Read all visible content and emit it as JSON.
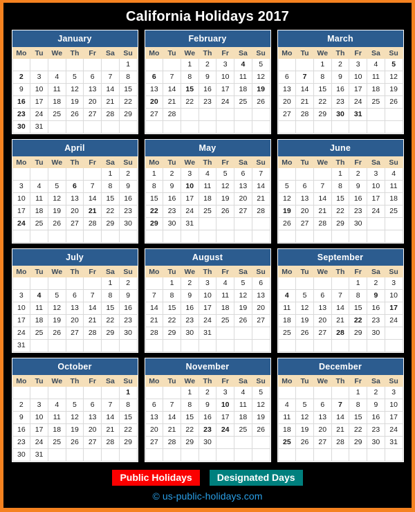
{
  "page": {
    "title": "California Holidays 2017",
    "background_color": "#000000",
    "border_color": "#f58220"
  },
  "weekday_headers": [
    "Mo",
    "Tu",
    "We",
    "Th",
    "Fr",
    "Sa",
    "Su"
  ],
  "legend": {
    "public_holidays_label": "Public Holidays",
    "public_holidays_color": "#fb0000",
    "designated_days_label": "Designated Days",
    "designated_days_color": "#00807e"
  },
  "copyright": "© us-public-holidays.com",
  "colors": {
    "month_header_bg": "#2c5c8f",
    "weekday_header_bg": "#f5dfb9",
    "saturday_text": "#1030c8",
    "sunday_text": "#d40000"
  },
  "months": [
    {
      "name": "January",
      "first_weekday_index": 6,
      "days_in_month": 31,
      "rows": 6,
      "public_holidays": [
        2,
        16
      ],
      "designated_days": [
        23,
        30
      ]
    },
    {
      "name": "February",
      "first_weekday_index": 2,
      "days_in_month": 28,
      "rows": 6,
      "public_holidays": [
        20
      ],
      "designated_days": [
        4,
        6,
        15,
        19
      ]
    },
    {
      "name": "March",
      "first_weekday_index": 2,
      "days_in_month": 31,
      "rows": 6,
      "public_holidays": [
        31
      ],
      "designated_days": [
        5,
        7,
        30
      ]
    },
    {
      "name": "April",
      "first_weekday_index": 5,
      "days_in_month": 30,
      "rows": 6,
      "public_holidays": [],
      "designated_days": [
        6,
        21,
        24
      ]
    },
    {
      "name": "May",
      "first_weekday_index": 0,
      "days_in_month": 31,
      "rows": 6,
      "public_holidays": [
        29
      ],
      "designated_days": [
        10,
        22
      ]
    },
    {
      "name": "June",
      "first_weekday_index": 3,
      "days_in_month": 30,
      "rows": 6,
      "public_holidays": [],
      "designated_days": [
        19
      ]
    },
    {
      "name": "July",
      "first_weekday_index": 5,
      "days_in_month": 31,
      "rows": 6,
      "public_holidays": [
        4
      ],
      "designated_days": []
    },
    {
      "name": "August",
      "first_weekday_index": 1,
      "days_in_month": 31,
      "rows": 6,
      "public_holidays": [],
      "designated_days": []
    },
    {
      "name": "September",
      "first_weekday_index": 4,
      "days_in_month": 30,
      "rows": 6,
      "public_holidays": [
        4
      ],
      "designated_days": [
        9,
        17,
        22,
        28
      ]
    },
    {
      "name": "October",
      "first_weekday_index": 6,
      "days_in_month": 31,
      "rows": 6,
      "public_holidays": [],
      "designated_days": [
        1
      ]
    },
    {
      "name": "November",
      "first_weekday_index": 2,
      "days_in_month": 30,
      "rows": 6,
      "public_holidays": [
        10,
        23,
        24
      ],
      "designated_days": []
    },
    {
      "name": "December",
      "first_weekday_index": 4,
      "days_in_month": 31,
      "rows": 6,
      "public_holidays": [
        25
      ],
      "designated_days": [
        7
      ]
    }
  ]
}
